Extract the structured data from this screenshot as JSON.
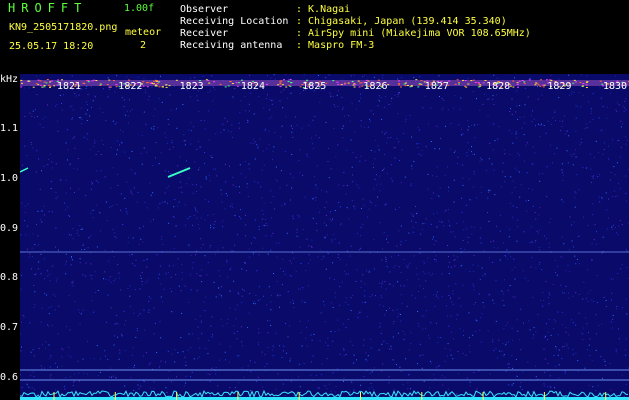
{
  "header": {
    "app_name": "HROFFT",
    "version": "1.00f",
    "filename": "KN9_2505171820.png",
    "meteor_label": "meteor",
    "meteor_count": "2",
    "datetime": "25.05.17 18:20"
  },
  "info": [
    {
      "label": "Observer",
      "value": ": K.Nagai"
    },
    {
      "label": "Receiving Location",
      "value": ": Chigasaki, Japan (139.414 35.340)"
    },
    {
      "label": "Receiver",
      "value": ": AirSpy mini (Miakejima VOR 108.65MHz)"
    },
    {
      "label": "Receiving antenna",
      "value": ": Maspro FM-3"
    }
  ],
  "chart_data": {
    "type": "heatmap",
    "ylabel": "kHz",
    "y_ticks": [
      "1.1",
      "1.0",
      "0.9",
      "0.8",
      "0.7",
      "0.6"
    ],
    "ylim": [
      0.59,
      1.2
    ],
    "x_ticks": [
      "1821",
      "1822",
      "1823",
      "1824",
      "1825",
      "1826",
      "1827",
      "1828",
      "1829",
      "1830"
    ],
    "colors": {
      "background": "#0a0a6a",
      "tone_line": "#7aa0ff",
      "echo": "#3cffc8",
      "noise_floor": "#33e6ff"
    }
  }
}
